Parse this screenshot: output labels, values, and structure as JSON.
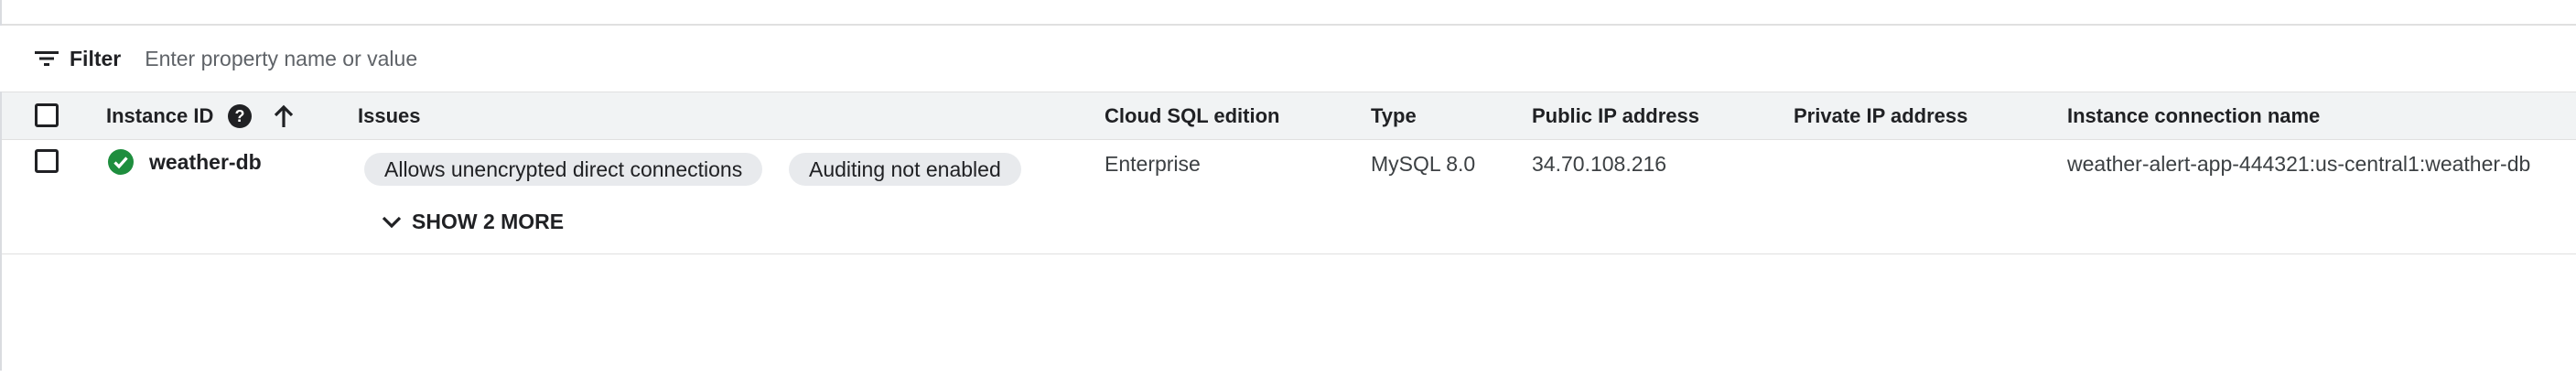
{
  "filter": {
    "label": "Filter",
    "placeholder": "Enter property name or value"
  },
  "table": {
    "columns": [
      "Instance ID",
      "Issues",
      "Cloud SQL edition",
      "Type",
      "Public IP address",
      "Private IP address",
      "Instance connection name"
    ],
    "rows": [
      {
        "instance_id": "weather-db",
        "issues": [
          "Allows unencrypted direct connections",
          "Auditing not enabled"
        ],
        "show_more_label": "SHOW 2 MORE",
        "edition": "Enterprise",
        "type": "MySQL 8.0",
        "public_ip": "34.70.108.216",
        "private_ip": "",
        "connection_name": "weather-alert-app-444321:us-central1:weather-db"
      }
    ]
  },
  "icons": {
    "filter": "filter-list-icon",
    "help": "help-icon",
    "sort": "arrow-upward-icon",
    "status": "check-circle-icon",
    "expand": "chevron-down-icon"
  },
  "colors": {
    "status_ok": "#1e8e3e",
    "header_bg": "#f1f3f4",
    "chip_bg": "#e8eaed"
  }
}
